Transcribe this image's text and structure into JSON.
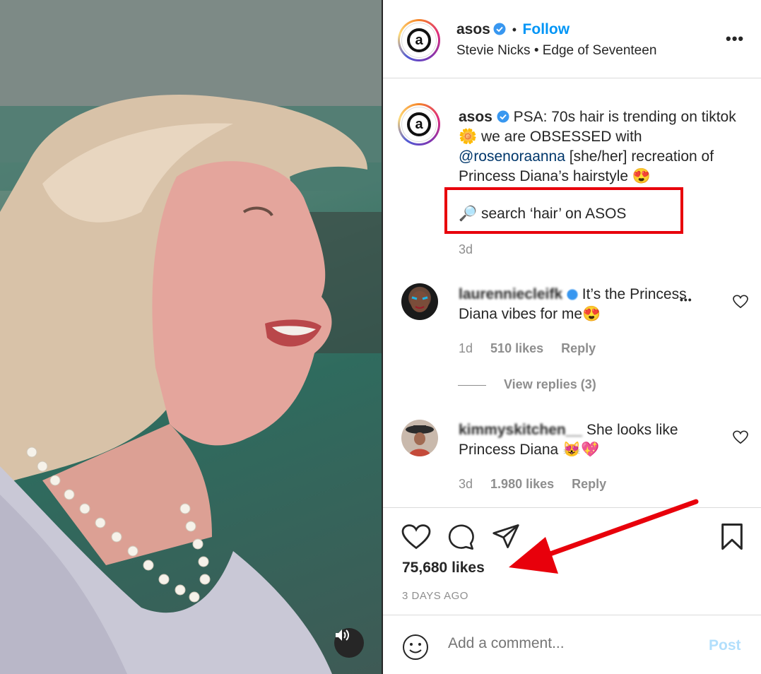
{
  "post": {
    "username": "asos",
    "dot": "•",
    "follow_label": "Follow",
    "audio_artist": "Stevie Nicks",
    "audio_separator": "•",
    "audio_track": "Edge of Seventeen",
    "more_glyph": "•••"
  },
  "caption": {
    "username": "asos",
    "text_part1": "PSA: 70s hair is trending on tiktok",
    "emoji1": "🌼",
    "text_part2": "we are OBSESSED with",
    "mention": "@rosenoraanna",
    "text_part3": "[she/her] recreation of Princess Diana’s hairstyle",
    "emoji2": "😍",
    "search_emoji": "🔎",
    "search_text": "search ‘hair’ on ASOS",
    "time": "3d"
  },
  "comments": [
    {
      "username": "laurenniecleifk",
      "text": "It’s the Princess Diana vibes for me😍",
      "time": "1d",
      "likes": "510 likes",
      "reply_label": "Reply",
      "more_glyph": "•••"
    },
    {
      "username": "kimmyskitchen__",
      "text": "She looks like Princess Diana 😻💖",
      "time": "3d",
      "likes": "1.980 likes",
      "reply_label": "Reply"
    }
  ],
  "view_replies_label": "View replies (3)",
  "actions": {
    "likes": "75,680 likes",
    "posted_ago": "3 DAYS AGO"
  },
  "add_comment": {
    "placeholder": "Add a comment...",
    "post_label": "Post"
  },
  "colors": {
    "follow_blue": "#0095f6",
    "annotation_red": "#e8000b",
    "post_disabled": "#b2dffc"
  }
}
